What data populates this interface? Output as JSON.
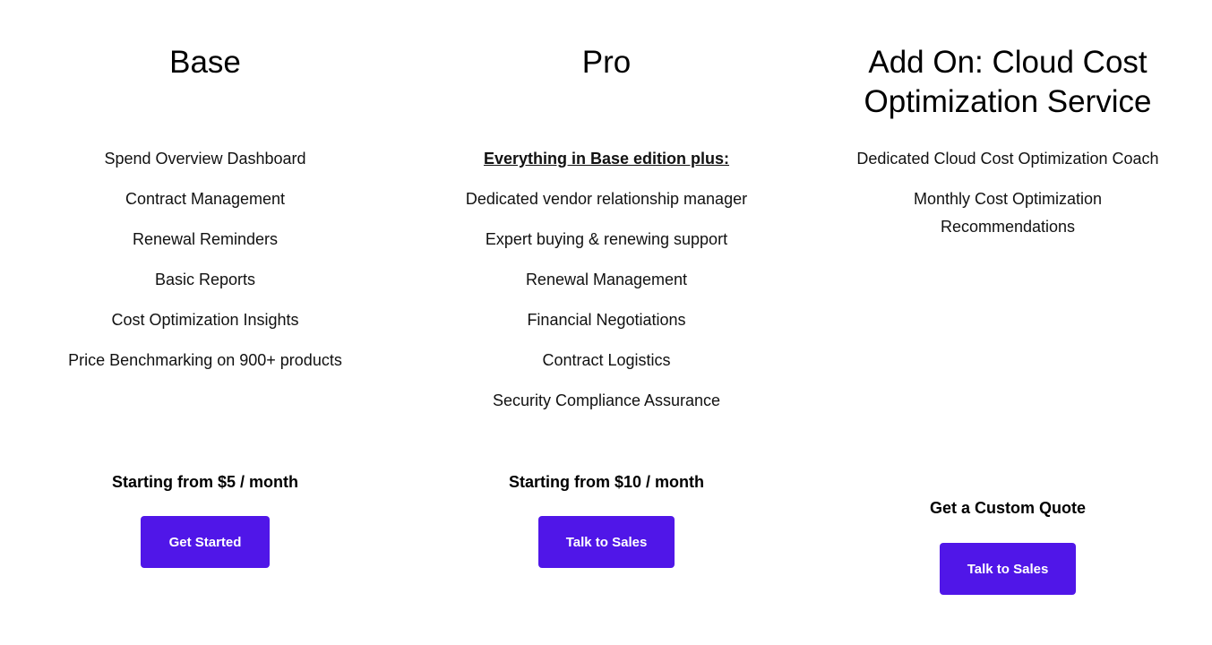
{
  "plans": {
    "base": {
      "title": "Base",
      "features": [
        "Spend Overview Dashboard",
        "Contract Management",
        "Renewal Reminders",
        "Basic Reports",
        "Cost Optimization Insights",
        "Price Benchmarking on 900+ products"
      ],
      "price": "Starting from $5 / month",
      "cta": "Get Started"
    },
    "pro": {
      "title": "Pro",
      "lead": "Everything in Base edition plus:",
      "features": [
        "Dedicated vendor relationship manager",
        "Expert buying & renewing support",
        "Renewal Management",
        "Financial Negotiations",
        "Contract Logistics",
        "Security Compliance Assurance"
      ],
      "price": "Starting from $10 / month",
      "cta": "Talk to Sales"
    },
    "addon": {
      "title": "Add On: Cloud Cost Optimization Service",
      "features": [
        "Dedicated Cloud Cost Optimization Coach",
        "Monthly Cost Optimization Recommendations"
      ],
      "price": "Get a Custom Quote",
      "cta": "Talk to Sales"
    }
  },
  "colors": {
    "button": "#5016e8",
    "button_text": "#ffffff"
  }
}
